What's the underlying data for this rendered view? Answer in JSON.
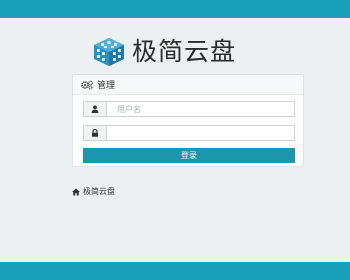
{
  "brand": {
    "name": "极简云盘",
    "logo_icon": "cube-logo-icon",
    "logo_color": "#2a8fc3"
  },
  "login_panel": {
    "heading_icon": "cogs-icon",
    "heading": "管理",
    "username_icon": "user-icon",
    "username_placeholder": "用户名",
    "password_icon": "lock-icon",
    "password_placeholder": "",
    "submit_label": "登录"
  },
  "footer": {
    "home_icon": "home-icon",
    "home_link": "极简云盘"
  },
  "colors": {
    "accent": "#1aa0b8",
    "button": "#1c96ad",
    "background": "#ecf0f3"
  }
}
